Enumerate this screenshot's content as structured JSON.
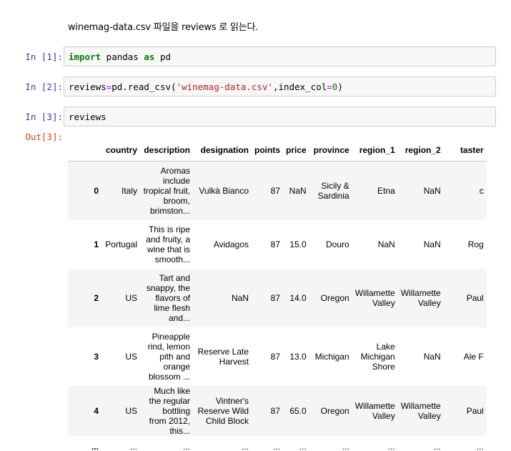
{
  "markdown": {
    "text": "winemag-data.csv 파일을 reviews 로 읽는다."
  },
  "cells": [
    {
      "prompt": "In [1]:",
      "tokens": [
        {
          "t": "import",
          "c": "kw"
        },
        {
          "t": " pandas ",
          "c": ""
        },
        {
          "t": "as",
          "c": "kw"
        },
        {
          "t": " pd",
          "c": ""
        }
      ]
    },
    {
      "prompt": "In [2]:",
      "tokens": [
        {
          "t": "reviews",
          "c": ""
        },
        {
          "t": "=",
          "c": "op"
        },
        {
          "t": "pd.read_csv(",
          "c": ""
        },
        {
          "t": "'winemag-data.csv'",
          "c": "str"
        },
        {
          "t": ",index_col",
          "c": ""
        },
        {
          "t": "=",
          "c": "op"
        },
        {
          "t": "0",
          "c": "num"
        },
        {
          "t": ")",
          "c": ""
        }
      ]
    },
    {
      "prompt": "In [3]:",
      "tokens": [
        {
          "t": "reviews",
          "c": ""
        }
      ]
    }
  ],
  "output": {
    "prompt": "Out[3]:",
    "columns": [
      "",
      "country",
      "description",
      "designation",
      "points",
      "price",
      "province",
      "region_1",
      "region_2",
      "taster"
    ],
    "rows": [
      [
        "0",
        "Italy",
        "Aromas include tropical fruit, broom, brimston...",
        "Vulkà Bianco",
        "87",
        "NaN",
        "Sicily & Sardinia",
        "Etna",
        "NaN",
        "c"
      ],
      [
        "1",
        "Portugal",
        "This is ripe and fruity, a wine that is smooth...",
        "Avidagos",
        "87",
        "15.0",
        "Douro",
        "NaN",
        "NaN",
        "Rog"
      ],
      [
        "2",
        "US",
        "Tart and snappy, the flavors of lime flesh and...",
        "NaN",
        "87",
        "14.0",
        "Oregon",
        "Willamette Valley",
        "Willamette Valley",
        "Paul"
      ],
      [
        "3",
        "US",
        "Pineapple rind, lemon pith and orange blossom ...",
        "Reserve Late Harvest",
        "87",
        "13.0",
        "Michigan",
        "Lake Michigan Shore",
        "NaN",
        "Ale F"
      ],
      [
        "4",
        "US",
        "Much like the regular bottling from 2012, this...",
        "Vintner's Reserve Wild Child Block",
        "87",
        "65.0",
        "Oregon",
        "Willamette Valley",
        "Willamette Valley",
        "Paul"
      ],
      [
        "...",
        "...",
        "...",
        "...",
        "...",
        "...",
        "...",
        "...",
        "...",
        "..."
      ]
    ]
  }
}
